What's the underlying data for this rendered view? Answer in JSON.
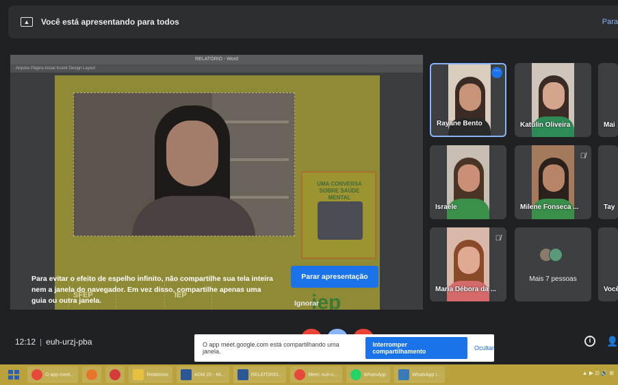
{
  "banner": {
    "text": "Você está apresentando para todos",
    "right_text": "Para",
    "icon": "present-to-all-icon"
  },
  "shared_screen": {
    "doc_title": "RELATÓRIO - Word",
    "doc_toolbar": "Arquivo  Página Inicial  Inserir  Design  Layout",
    "poster_title": "UMA CONVERSA SOBRE SAÚDE MENTAL",
    "logo_left": "SFEP",
    "logo_mid": "IEP",
    "logo_right": "iep"
  },
  "warning": {
    "text": "Para evitar o efeito de espelho infinito, não compartilhe sua tela inteira nem a janela do navegador. Em vez disso, compartilhe apenas uma guia ou outra janela.",
    "stop_label": "Parar apresentação",
    "ignore_label": "Ignorar"
  },
  "participants": [
    {
      "name": "Rayane Bento",
      "active": true,
      "muted": false
    },
    {
      "name": "Katulin Oliveira",
      "active": false,
      "muted": false
    },
    {
      "name": "Mai",
      "active": false,
      "muted": false
    },
    {
      "name": "Israele",
      "active": false,
      "muted": false
    },
    {
      "name": "Milene Fonseca ...",
      "active": false,
      "muted": true
    },
    {
      "name": "Tay",
      "active": false,
      "muted": false
    },
    {
      "name": "Maria Débora da ...",
      "active": false,
      "muted": true
    },
    {
      "name": "Mais 7 pessoas",
      "active": false,
      "muted": false
    },
    {
      "name": "Você",
      "active": false,
      "muted": false
    }
  ],
  "meeting": {
    "time": "12:12",
    "separator": "|",
    "code": "euh-urzj-pba"
  },
  "notification": {
    "text": "O app meet.google.com está compartilhando uma janela.",
    "stop_label": "Interromper compartilhamento",
    "hide_label": "Ocultar"
  },
  "taskbar": {
    "items": [
      {
        "label": "O app meet...",
        "icon": "chrome-icon"
      },
      {
        "label": "",
        "icon": "firefox-icon"
      },
      {
        "label": "",
        "icon": "opera-icon"
      },
      {
        "label": "Relatórios",
        "icon": "folder-icon"
      },
      {
        "label": "ADM 20 - Mi...",
        "icon": "word-icon"
      },
      {
        "label": "RELATÓRIO...",
        "icon": "word-icon"
      },
      {
        "label": "Meet: euh-u...",
        "icon": "chrome-icon"
      },
      {
        "label": "WhatsApp",
        "icon": "whatsapp-icon"
      },
      {
        "label": "WhatsApp I...",
        "icon": "monitor-icon"
      }
    ],
    "tray": "▲ ▶ ⊡ 🔊 ⊞"
  },
  "colors": {
    "accent": "#1a73e8",
    "bg": "#202124",
    "taskbar": "#b9a23c"
  }
}
